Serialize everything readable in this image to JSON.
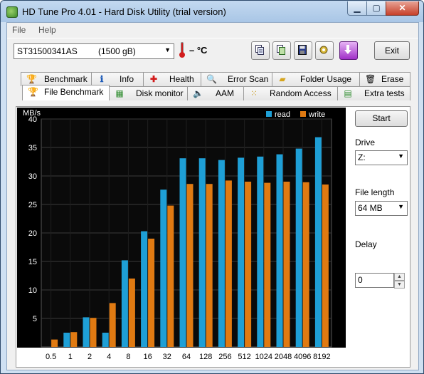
{
  "window": {
    "title": "HD Tune Pro 4.01 - Hard Disk Utility (trial version)",
    "min_glyph": "▁",
    "max_glyph": "▢",
    "close_glyph": "✕"
  },
  "menu": {
    "items": [
      "File",
      "Help"
    ]
  },
  "toolbar": {
    "drive_model": "ST31500341AS",
    "drive_size": "(1500 gB)",
    "temperature": "– °C",
    "exit_label": "Exit",
    "buttons": [
      "copy-info-icon",
      "copy-screenshot-icon",
      "save-icon",
      "options-icon",
      "download-icon"
    ]
  },
  "tabs": {
    "row1": [
      {
        "label": "Benchmark",
        "icon": "benchmark-icon"
      },
      {
        "label": "Info",
        "icon": "info-icon"
      },
      {
        "label": "Health",
        "icon": "health-icon"
      },
      {
        "label": "Error Scan",
        "icon": "error-scan-icon"
      },
      {
        "label": "Folder Usage",
        "icon": "folder-icon"
      },
      {
        "label": "Erase",
        "icon": "erase-icon"
      }
    ],
    "row2": [
      {
        "label": "File Benchmark",
        "icon": "file-benchmark-icon",
        "active": true
      },
      {
        "label": "Disk monitor",
        "icon": "disk-monitor-icon"
      },
      {
        "label": "AAM",
        "icon": "aam-icon"
      },
      {
        "label": "Random Access",
        "icon": "random-access-icon"
      },
      {
        "label": "Extra tests",
        "icon": "extra-tests-icon"
      }
    ]
  },
  "side": {
    "start_label": "Start",
    "drive_label": "Drive",
    "drive_value": "Z:",
    "file_length_label": "File length",
    "file_length_value": "64 MB",
    "delay_label": "Delay",
    "delay_value": "0"
  },
  "colors": {
    "read": "#1e9fd6",
    "write": "#e07a12",
    "background": "#000000",
    "grid": "#3a3a3a"
  },
  "chart_data": {
    "type": "bar",
    "ylabel": "MB/s",
    "ylim": [
      0,
      40
    ],
    "yticks": [
      5,
      10,
      15,
      20,
      25,
      30,
      35,
      40
    ],
    "grid": true,
    "legend_position": "top-right",
    "categories": [
      "0.5",
      "1",
      "2",
      "4",
      "8",
      "16",
      "32",
      "64",
      "128",
      "256",
      "512",
      "1024",
      "2048",
      "4096",
      "8192"
    ],
    "series": [
      {
        "name": "read",
        "values": [
          0,
          2.5,
          5.2,
          2.5,
          15.2,
          20.3,
          27.6,
          33.1,
          33.1,
          32.8,
          33.2,
          33.4,
          33.8,
          34.8,
          36.8
        ]
      },
      {
        "name": "write",
        "values": [
          1.3,
          2.6,
          5.1,
          7.7,
          12.0,
          19.0,
          24.8,
          28.6,
          28.6,
          29.2,
          29.0,
          28.8,
          29.0,
          28.9,
          28.5
        ]
      }
    ]
  }
}
